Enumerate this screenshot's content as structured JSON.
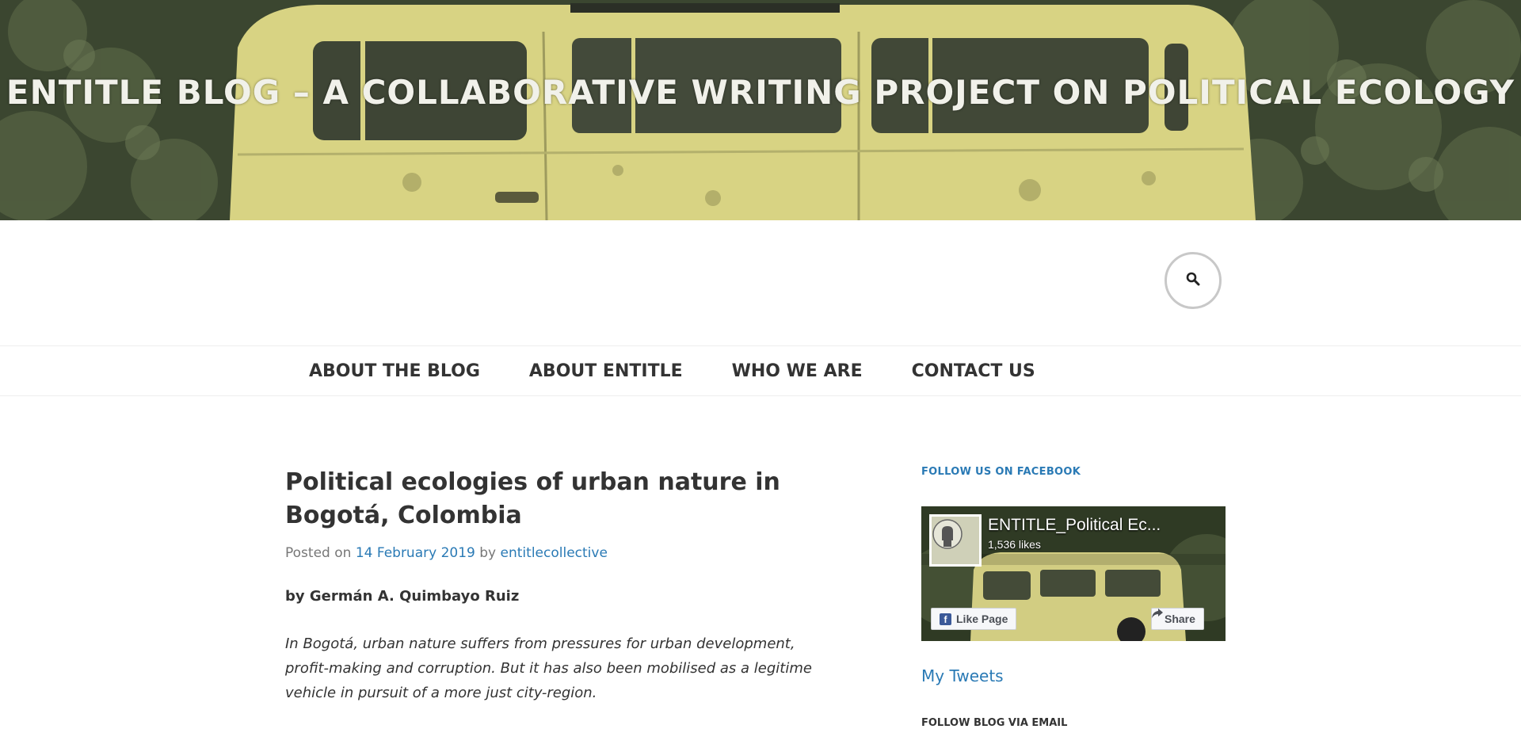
{
  "header": {
    "site_title": "ENTITLE BLOG – A COLLABORATIVE WRITING PROJECT ON POLITICAL ECOLOGY"
  },
  "search": {
    "icon": "search-icon"
  },
  "nav": {
    "items": [
      {
        "label": "ABOUT THE BLOG"
      },
      {
        "label": "ABOUT ENTITLE"
      },
      {
        "label": "WHO WE ARE"
      },
      {
        "label": "CONTACT US"
      }
    ]
  },
  "post": {
    "title": "Political ecologies of urban nature in Bogotá, Colombia",
    "meta_prefix": "Posted on",
    "date": "14 February 2019",
    "meta_by": "by",
    "author": "entitlecollective",
    "byline": "by Germán A. Quimbayo Ruiz",
    "lead": "In Bogotá, urban nature suffers from pressures for urban development, profit-making and corruption. But it has also been mobilised as a legitime vehicle in pursuit of a more just city-region."
  },
  "sidebar": {
    "facebook_title": "FOLLOW US ON FACEBOOK",
    "fb_page_name": "ENTITLE_Political Ec...",
    "fb_likes": "1,536 likes",
    "fb_like_button": "Like Page",
    "fb_share_button": "Share",
    "tweets_link": "My Tweets",
    "email_title": "FOLLOW BLOG VIA EMAIL"
  },
  "colors": {
    "accent_link": "#2a7ab5",
    "banner_van": "#d8d383",
    "banner_foliage": "#3c4731"
  }
}
